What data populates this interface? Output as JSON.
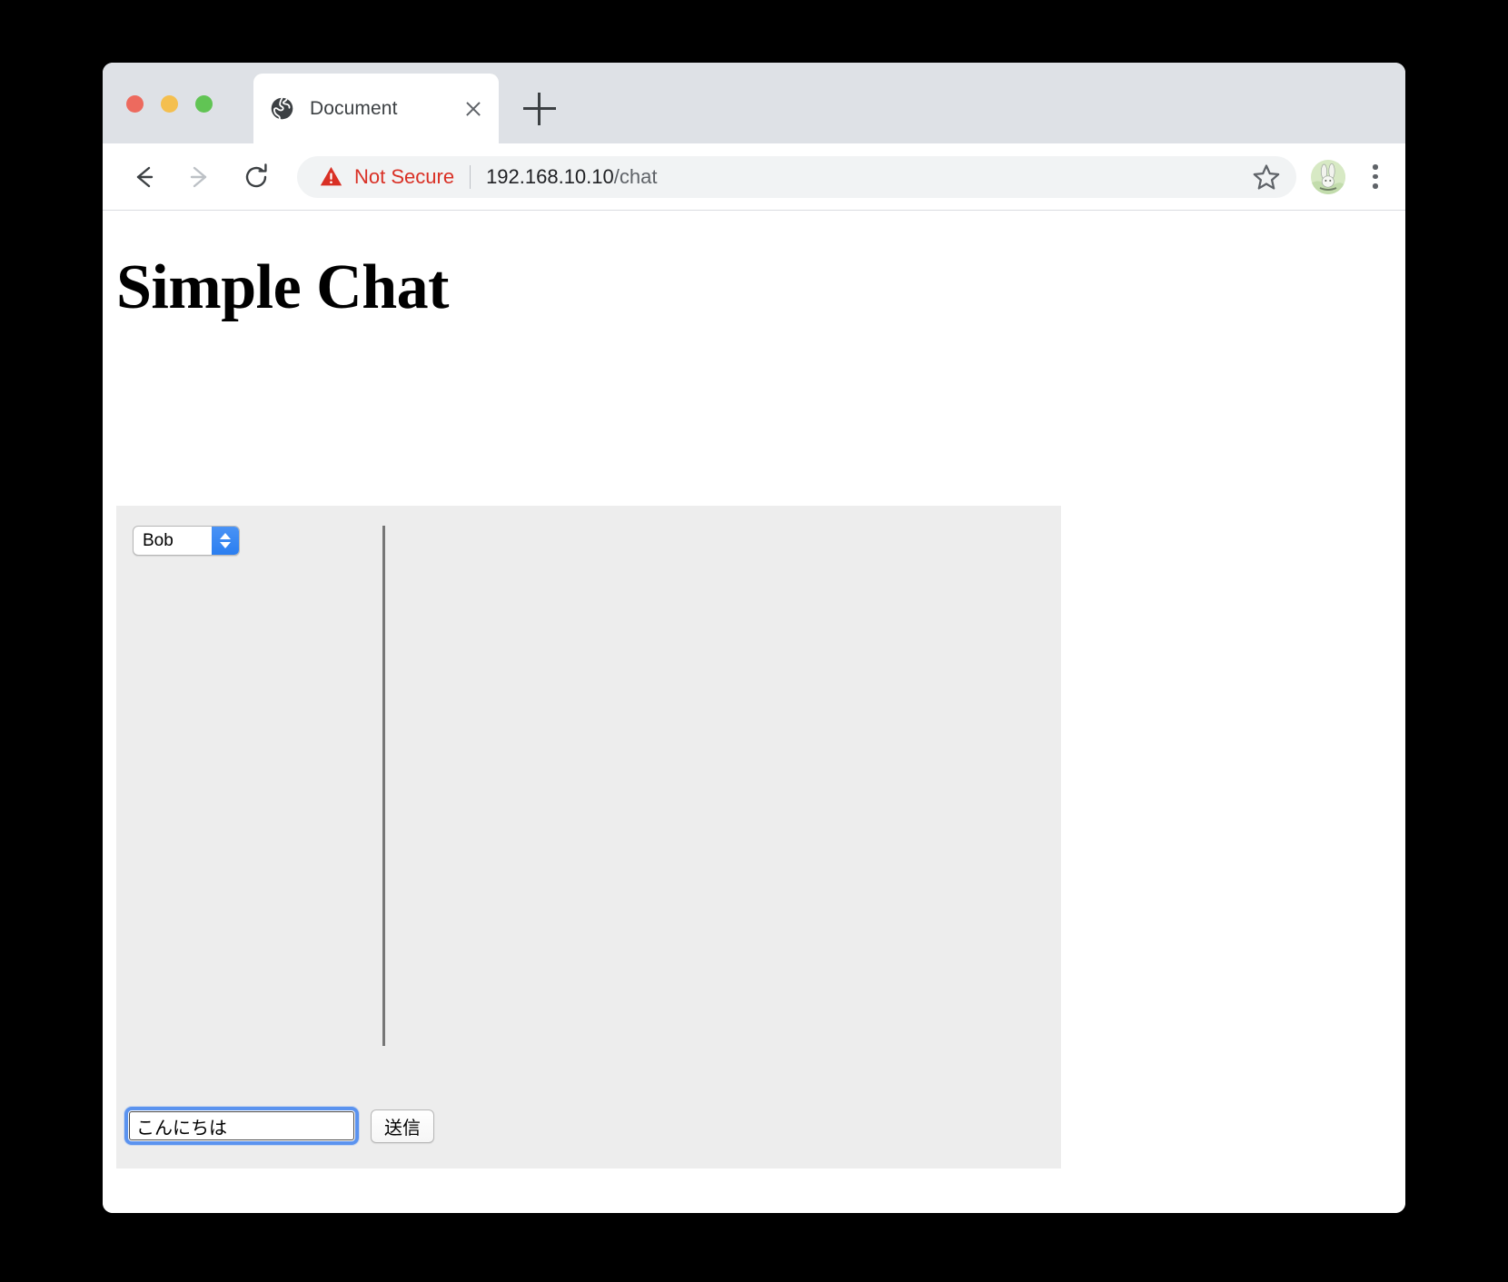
{
  "window": {
    "traffic_lights": [
      "close",
      "minimize",
      "zoom"
    ],
    "colors": {
      "close": "#ed6a5e",
      "minimize": "#f4bf4f",
      "zoom": "#61c454",
      "tabstrip_bg": "#dee1e6",
      "omnibox_bg": "#f1f3f4",
      "not_secure": "#d93025",
      "panel_bg": "#ededed",
      "focus_ring": "#5b93ef",
      "select_arrow_bg": "#2b7ef0"
    }
  },
  "tabs": [
    {
      "title": "Document",
      "favicon": "globe-icon",
      "close_label": "×",
      "active": true
    }
  ],
  "new_tab": {
    "label": "+"
  },
  "toolbar": {
    "back": "back-arrow-icon",
    "forward": "forward-arrow-icon",
    "reload": "reload-icon",
    "security": {
      "icon": "warning-triangle-icon",
      "label": "Not Secure"
    },
    "url": {
      "host": "192.168.10.10",
      "path": "/chat"
    },
    "bookmark": "star-icon",
    "profile": "avatar",
    "menu": "kebab-menu-icon"
  },
  "page": {
    "title": "Simple Chat",
    "user_select": {
      "value": "Bob",
      "options": [
        "Bob"
      ]
    },
    "messages": [],
    "composer": {
      "input_value": "こんにちは",
      "input_placeholder": "",
      "send_label": "送信"
    }
  }
}
